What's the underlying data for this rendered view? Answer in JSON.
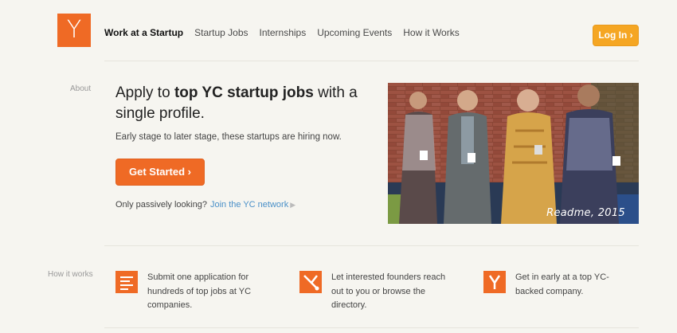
{
  "logo": {
    "letter": "Y"
  },
  "nav": {
    "items": [
      {
        "label": "Work at a Startup",
        "active": true
      },
      {
        "label": "Startup Jobs"
      },
      {
        "label": "Internships"
      },
      {
        "label": "Upcoming Events"
      },
      {
        "label": "How it Works"
      }
    ]
  },
  "login": {
    "label": "Log In ›"
  },
  "about": {
    "label": "About"
  },
  "hero": {
    "headline_pre": "Apply to ",
    "headline_bold": "top YC startup jobs",
    "headline_post": " with a single profile.",
    "subhead": "Early stage to later stage, these startups are hiring now.",
    "cta": "Get Started ›",
    "passive_text": "Only passively looking?",
    "passive_link": "Join the YC network",
    "passive_arrow": "▶"
  },
  "photo": {
    "caption": "Readme, 2015"
  },
  "how": {
    "label": "How it works",
    "steps": [
      {
        "text": "Submit one application for hundreds of top jobs at YC companies.",
        "icon": "list-icon"
      },
      {
        "text": "Let interested founders reach out to you or browse the directory.",
        "icon": "connect-icon"
      },
      {
        "text": "Get in early at a top YC-backed company.",
        "icon": "yc-icon"
      }
    ]
  },
  "colors": {
    "accent": "#ef6a25",
    "login": "#f5a623",
    "link": "#4a90c8",
    "background": "#f6f5f0"
  }
}
